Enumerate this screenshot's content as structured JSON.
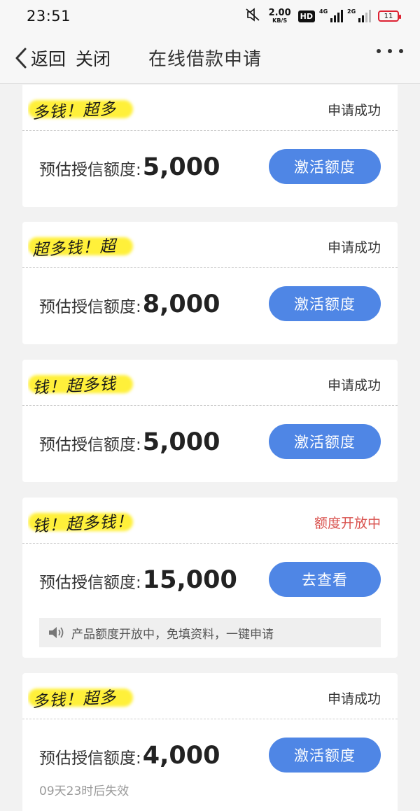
{
  "status_bar": {
    "time": "23:51",
    "net_speed": "2.00",
    "net_unit": "KB/S",
    "hd": "HD",
    "signal1": "4G",
    "signal2": "2G",
    "battery": "11",
    "icons": [
      "mute-icon",
      "hd-icon",
      "signal-4g-icon",
      "signal-2g-icon",
      "battery-icon"
    ]
  },
  "nav": {
    "back_label": "返回",
    "close_label": "关闭",
    "title": "在线借款申请"
  },
  "cards": [
    {
      "logo": "多钱！超多",
      "status": "申请成功",
      "amount_label": "预估授信额度:",
      "amount": "5,000",
      "button": "激活额度"
    },
    {
      "logo": "超多钱！超",
      "status": "申请成功",
      "amount_label": "预估授信额度:",
      "amount": "8,000",
      "button": "激活额度"
    },
    {
      "logo": "钱！超多钱",
      "status": "申请成功",
      "amount_label": "预估授信额度:",
      "amount": "5,000",
      "button": "激活额度"
    },
    {
      "logo": "钱！超多钱！",
      "status": "额度开放中",
      "amount_label": "预估授信额度:",
      "amount": "15,000",
      "button": "去查看",
      "notice": "产品额度开放中，免填资料，一键申请"
    },
    {
      "logo": "多钱！超多",
      "status": "申请成功",
      "amount_label": "预估授信额度:",
      "amount": "4,000",
      "button": "激活额度",
      "expiry": "09天23时后失效"
    }
  ],
  "colors": {
    "accent": "#4f86e5",
    "open_status": "#d9534f",
    "logo_highlight": "#fff03a"
  }
}
